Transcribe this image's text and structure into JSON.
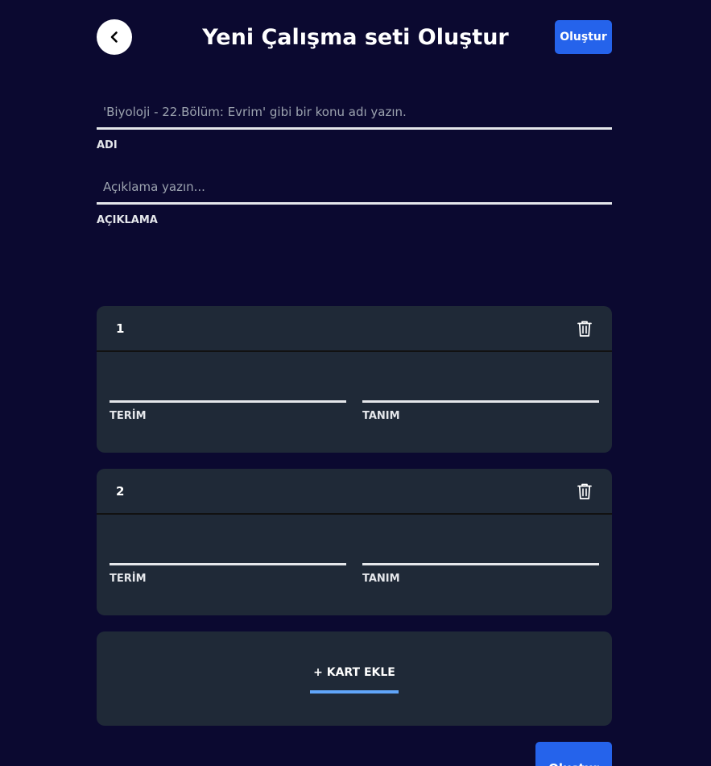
{
  "header": {
    "title": "Yeni Çalışma seti Oluştur",
    "create_label": "Oluştur",
    "back_icon": "chevron-left-icon"
  },
  "name_field": {
    "placeholder": "'Biyoloji - 22.Bölüm: Evrim' gibi bir konu adı yazın.",
    "value": "",
    "label": "ADI"
  },
  "description_field": {
    "placeholder": "Açıklama yazın...",
    "value": "",
    "label": "AÇIKLAMA"
  },
  "cards": [
    {
      "number": "1",
      "term_label": "TERİM",
      "definition_label": "TANIM",
      "term_value": "",
      "definition_value": ""
    },
    {
      "number": "2",
      "term_label": "TERİM",
      "definition_label": "TANIM",
      "term_value": "",
      "definition_value": ""
    }
  ],
  "add_card": {
    "label": "+ KART EKLE"
  },
  "footer": {
    "create_label": "Oluştur"
  },
  "colors": {
    "background": "#0b0930",
    "card": "#1f2937",
    "accent": "#2563eb",
    "underline_accent": "#60a5fa"
  }
}
